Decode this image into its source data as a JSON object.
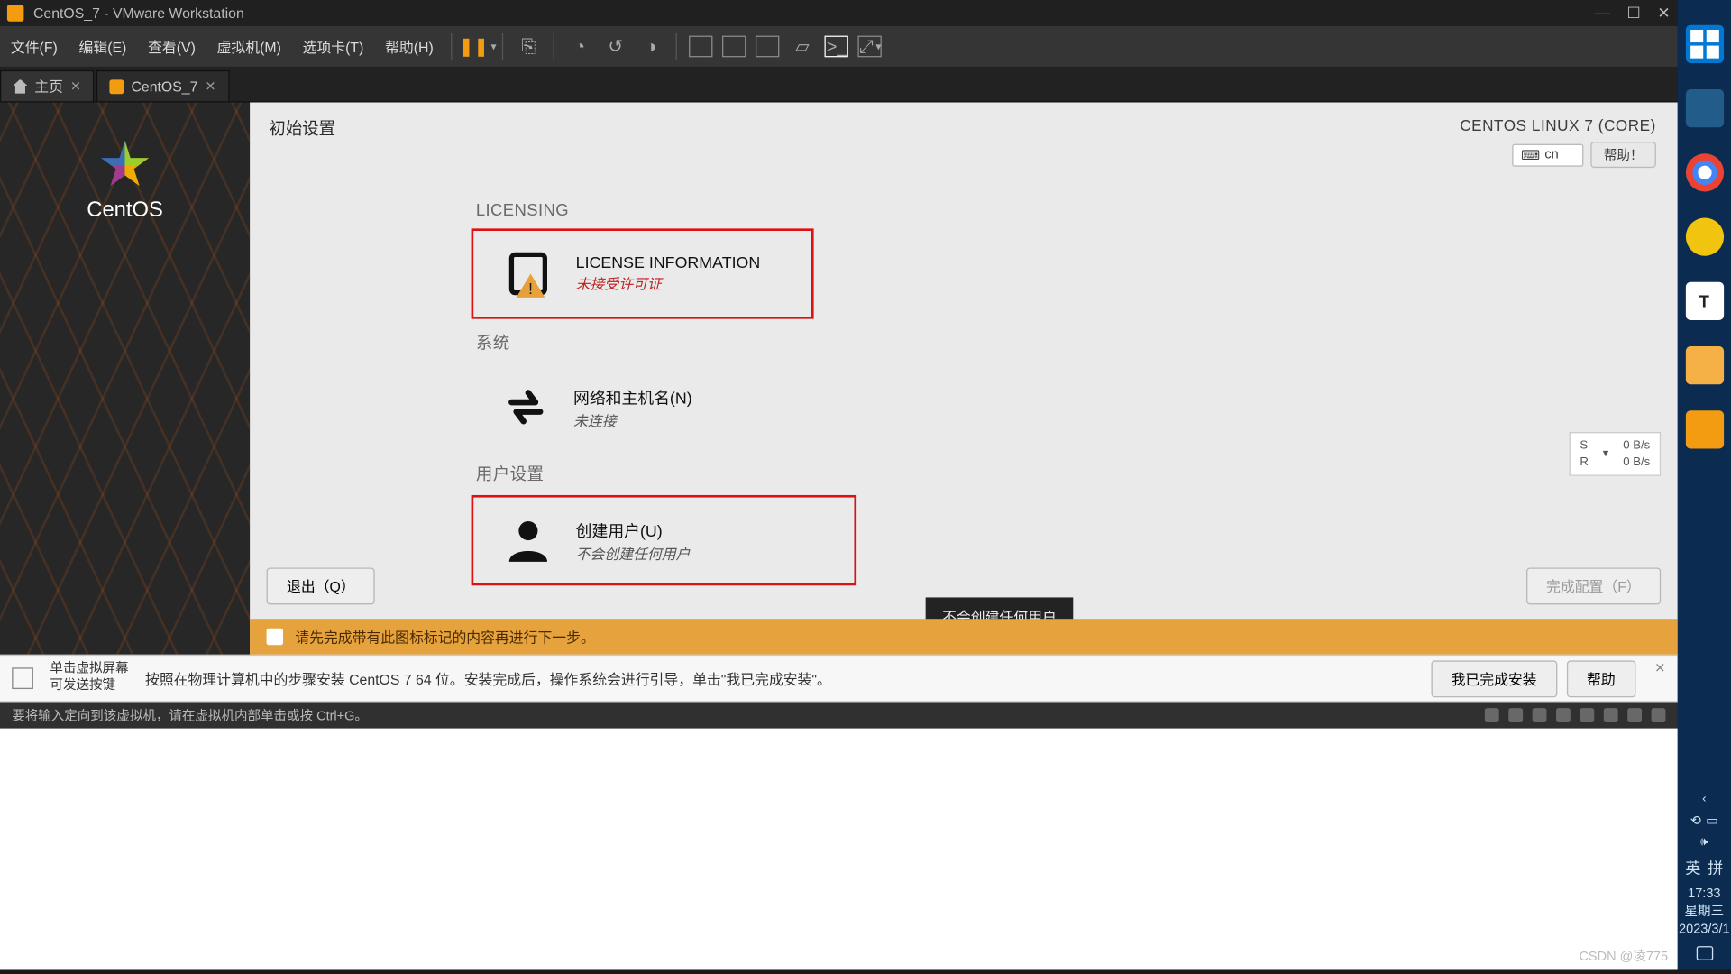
{
  "titlebar": {
    "title": "CentOS_7 - VMware Workstation"
  },
  "menubar": {
    "file": "文件(F)",
    "edit": "编辑(E)",
    "view": "查看(V)",
    "vm": "虚拟机(M)",
    "tabs": "选项卡(T)",
    "help": "帮助(H)"
  },
  "tabs": {
    "home": "主页",
    "vm": "CentOS_7"
  },
  "sidebar": {
    "brand": "CentOS"
  },
  "guest": {
    "title": "初始设置",
    "distro": "CENTOS LINUX 7 (CORE)",
    "lang_code": "cn",
    "help_label": "帮助！",
    "sections": {
      "licensing_heading": "LICENSING",
      "license": {
        "title": "LICENSE INFORMATION",
        "status": "未接受许可证"
      },
      "system_heading": "系统",
      "network": {
        "title": "网络和主机名(N)",
        "status": "未连接"
      },
      "user_heading": "用户设置",
      "user": {
        "title": "创建用户(U)",
        "status": "不会创建任何用户"
      }
    },
    "tooltip": "不会创建任何用户",
    "net_rate": {
      "s_label": "S",
      "r_label": "R",
      "s_val": "0 B/s",
      "r_val": "0 B/s",
      "arrow": "▾"
    },
    "footer": {
      "quit": "退出（Q）",
      "finish": "完成配置（F）"
    },
    "orange_msg": "请先完成带有此图标标记的内容再进行下一步。"
  },
  "vm_hint": {
    "grab_line1": "单击虚拟屏幕",
    "grab_line2": "可发送按键",
    "instruction": "按照在物理计算机中的步骤安装 CentOS 7 64 位。安装完成后，操作系统会进行引导，单击\"我已完成安装\"。",
    "done_btn": "我已完成安装",
    "help_btn": "帮助"
  },
  "vm_status": {
    "msg": "要将输入定向到该虚拟机，请在虚拟机内部单击或按 Ctrl+G。"
  },
  "csdn": "CSDN @凌775",
  "win_tray": {
    "ime_lang": "英",
    "ime_mode": "拼",
    "time": "17:33",
    "weekday": "星期三",
    "date": "2023/3/1"
  }
}
